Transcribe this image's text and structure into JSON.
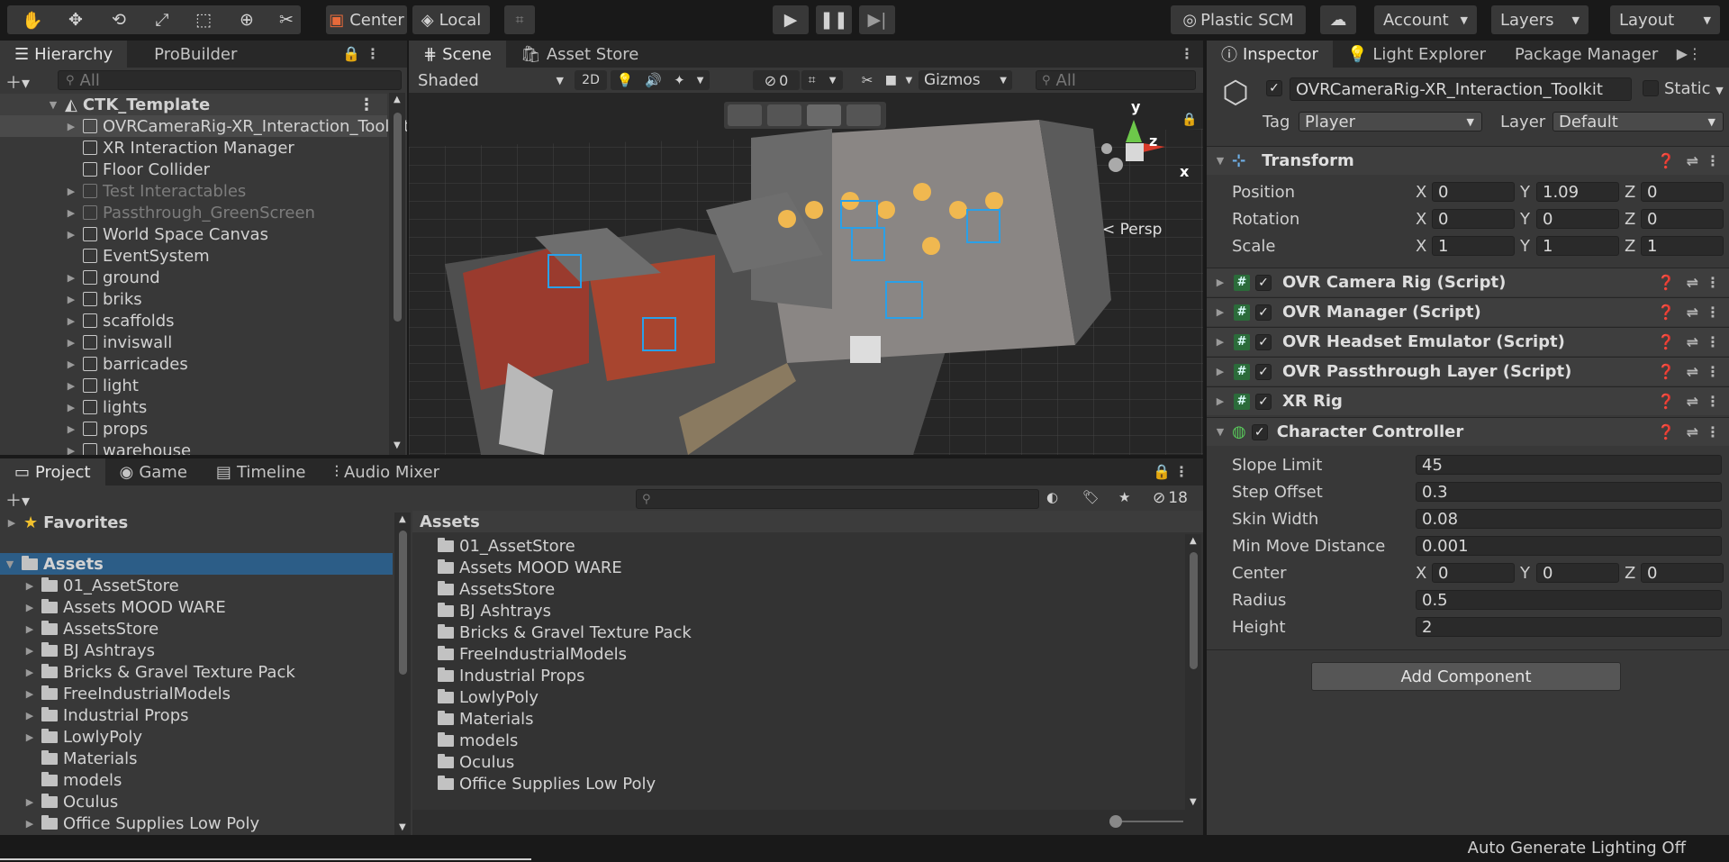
{
  "toolbar": {
    "pivot_label": "Center",
    "space_label": "Local",
    "plastic_label": "Plastic SCM",
    "account_label": "Account",
    "layers_label": "Layers",
    "layout_label": "Layout"
  },
  "hierarchy": {
    "tabs": [
      "Hierarchy",
      "ProBuilder"
    ],
    "search_placeholder": "All",
    "scene_name": "CTK_Template",
    "items": [
      {
        "label": "OVRCameraRig-XR_Interaction_Toolkit",
        "indent": 1,
        "arrow": true,
        "selected": true,
        "dim": false
      },
      {
        "label": "XR Interaction Manager",
        "indent": 1,
        "arrow": false,
        "dim": false
      },
      {
        "label": "Floor Collider",
        "indent": 1,
        "arrow": false,
        "dim": false
      },
      {
        "label": "Test Interactables",
        "indent": 1,
        "arrow": true,
        "dim": true
      },
      {
        "label": "Passthrough_GreenScreen",
        "indent": 1,
        "arrow": true,
        "dim": true
      },
      {
        "label": "World Space Canvas",
        "indent": 1,
        "arrow": true,
        "dim": false
      },
      {
        "label": "EventSystem",
        "indent": 1,
        "arrow": false,
        "dim": false
      },
      {
        "label": "ground",
        "indent": 1,
        "arrow": true,
        "dim": false
      },
      {
        "label": "briks",
        "indent": 1,
        "arrow": true,
        "dim": false
      },
      {
        "label": "scaffolds",
        "indent": 1,
        "arrow": true,
        "dim": false
      },
      {
        "label": "inviswall",
        "indent": 1,
        "arrow": true,
        "dim": false
      },
      {
        "label": "barricades",
        "indent": 1,
        "arrow": true,
        "dim": false
      },
      {
        "label": "light",
        "indent": 1,
        "arrow": true,
        "dim": false
      },
      {
        "label": "lights",
        "indent": 1,
        "arrow": true,
        "dim": false
      },
      {
        "label": "props",
        "indent": 1,
        "arrow": true,
        "dim": false
      },
      {
        "label": "warehouse",
        "indent": 1,
        "arrow": true,
        "dim": false
      }
    ]
  },
  "scene": {
    "tabs": [
      "Scene",
      "Asset Store"
    ],
    "shading": "Shaded",
    "mode_2d": "2D",
    "hidden_count": "0",
    "gizmos": "Gizmos",
    "search_placeholder": "All",
    "persp_label": "< Persp",
    "axis_y": "y",
    "axis_z": "z",
    "axis_x": "x"
  },
  "project": {
    "tabs": [
      "Project",
      "Game",
      "Timeline",
      "Audio Mixer"
    ],
    "hidden_count": "18",
    "favorites": "Favorites",
    "assets_root": "Assets",
    "breadcrumb": "Assets",
    "tree": [
      {
        "label": "01_AssetStore",
        "arrow": true
      },
      {
        "label": "Assets MOOD WARE",
        "arrow": true
      },
      {
        "label": "AssetsStore",
        "arrow": true
      },
      {
        "label": "BJ Ashtrays",
        "arrow": true
      },
      {
        "label": "Bricks & Gravel Texture Pack",
        "arrow": true
      },
      {
        "label": "FreeIndustrialModels",
        "arrow": true
      },
      {
        "label": "Industrial Props",
        "arrow": true
      },
      {
        "label": "LowlyPoly",
        "arrow": true
      },
      {
        "label": "Materials",
        "arrow": false
      },
      {
        "label": "models",
        "arrow": false
      },
      {
        "label": "Oculus",
        "arrow": true
      },
      {
        "label": "Office Supplies Low Poly",
        "arrow": true
      }
    ],
    "list": [
      "01_AssetStore",
      "Assets MOOD WARE",
      "AssetsStore",
      "BJ Ashtrays",
      "Bricks & Gravel Texture Pack",
      "FreeIndustrialModels",
      "Industrial Props",
      "LowlyPoly",
      "Materials",
      "models",
      "Oculus",
      "Office Supplies Low Poly"
    ]
  },
  "inspector": {
    "tabs": [
      "Inspector",
      "Light Explorer",
      "Package Manager"
    ],
    "object_name": "OVRCameraRig-XR_Interaction_Toolkit",
    "static_label": "Static",
    "tag_label": "Tag",
    "tag_value": "Player",
    "layer_label": "Layer",
    "layer_value": "Default",
    "transform": {
      "title": "Transform",
      "position_label": "Position",
      "rotation_label": "Rotation",
      "scale_label": "Scale",
      "x": "X",
      "y": "Y",
      "z": "Z",
      "position": [
        "0",
        "1.09",
        "0"
      ],
      "rotation": [
        "0",
        "0",
        "0"
      ],
      "scale": [
        "1",
        "1",
        "1"
      ]
    },
    "scripts": [
      "OVR Camera Rig (Script)",
      "OVR Manager (Script)",
      "OVR Headset Emulator (Script)",
      "OVR Passthrough Layer (Script)",
      "XR Rig"
    ],
    "cc": {
      "title": "Character Controller",
      "fields": [
        {
          "label": "Slope Limit",
          "value": "45"
        },
        {
          "label": "Step Offset",
          "value": "0.3"
        },
        {
          "label": "Skin Width",
          "value": "0.08"
        },
        {
          "label": "Min Move Distance",
          "value": "0.001"
        }
      ],
      "center_label": "Center",
      "center": [
        "0",
        "0",
        "0"
      ],
      "radius_label": "Radius",
      "radius": "0.5",
      "height_label": "Height",
      "height": "2"
    },
    "add_component": "Add Component"
  },
  "status": {
    "lighting": "Auto Generate Lighting Off"
  }
}
